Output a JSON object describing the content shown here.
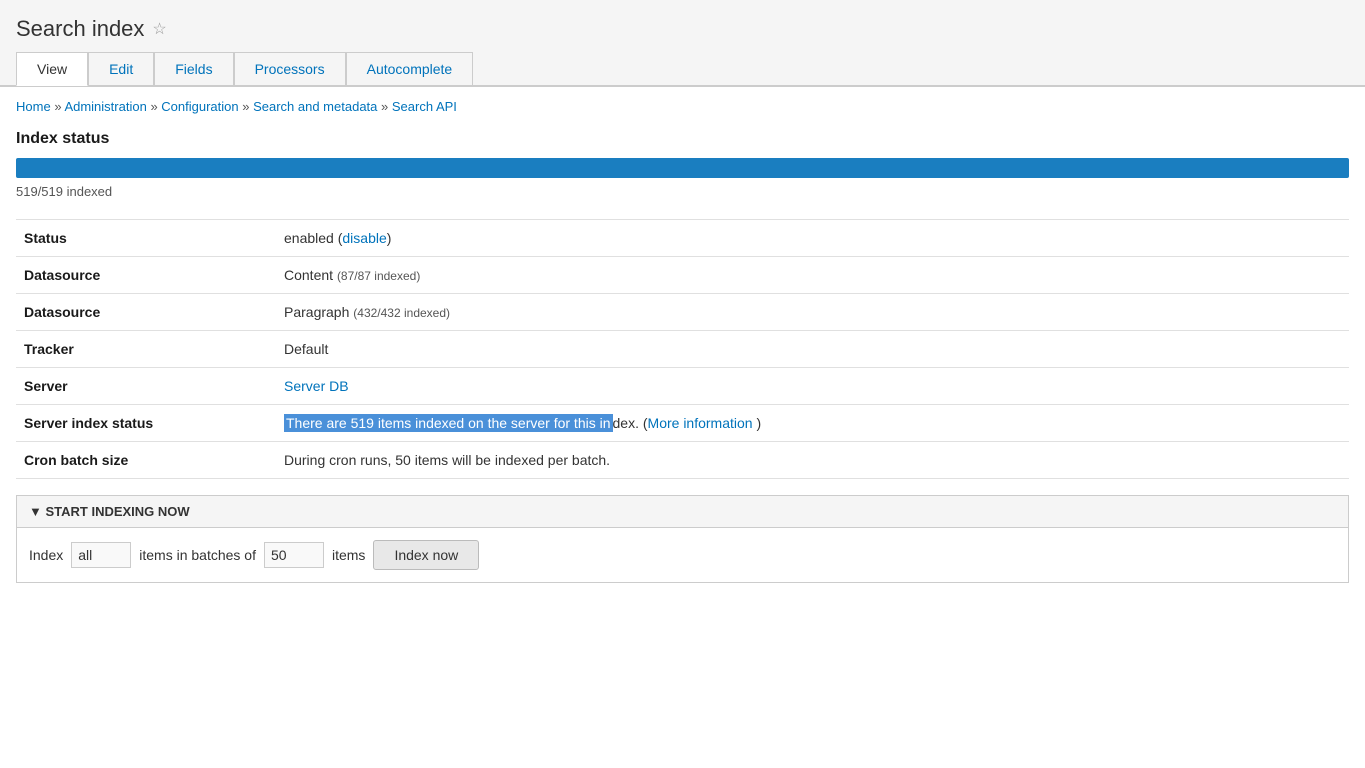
{
  "page": {
    "title": "Search index",
    "star_icon": "☆"
  },
  "tabs": [
    {
      "label": "View",
      "active": true
    },
    {
      "label": "Edit",
      "active": false
    },
    {
      "label": "Fields",
      "active": false
    },
    {
      "label": "Processors",
      "active": false
    },
    {
      "label": "Autocomplete",
      "active": false
    }
  ],
  "breadcrumb": {
    "items": [
      "Home",
      "Administration",
      "Configuration",
      "Search and metadata",
      "Search API"
    ],
    "separator": "»"
  },
  "index_status": {
    "section_title": "Index status",
    "progress_percent": 100,
    "progress_label": "519/519 indexed"
  },
  "info_rows": [
    {
      "label": "Status",
      "value": "enabled",
      "link_text": "disable",
      "link_after": ""
    },
    {
      "label": "Datasource",
      "value": "Content",
      "extra": "(87/87 indexed)"
    },
    {
      "label": "Datasource",
      "value": "Paragraph",
      "extra": "(432/432 indexed)"
    },
    {
      "label": "Tracker",
      "value": "Default"
    },
    {
      "label": "Server",
      "value": "",
      "link_text": "Server DB"
    },
    {
      "label": "Server index status",
      "highlighted": "There are 519 items indexed on the server for this in",
      "normal_after": "dex. (",
      "link_text": "More information",
      "link_close": " )"
    },
    {
      "label": "Cron batch size",
      "value": "During cron runs, 50 items will be indexed per batch."
    }
  ],
  "indexing_section": {
    "header": "▼ START INDEXING NOW",
    "prefix_text": "Index",
    "all_value": "all",
    "batches_label": "items in batches of",
    "batch_value": "50",
    "items_label": "items",
    "button_label": "Index now"
  }
}
